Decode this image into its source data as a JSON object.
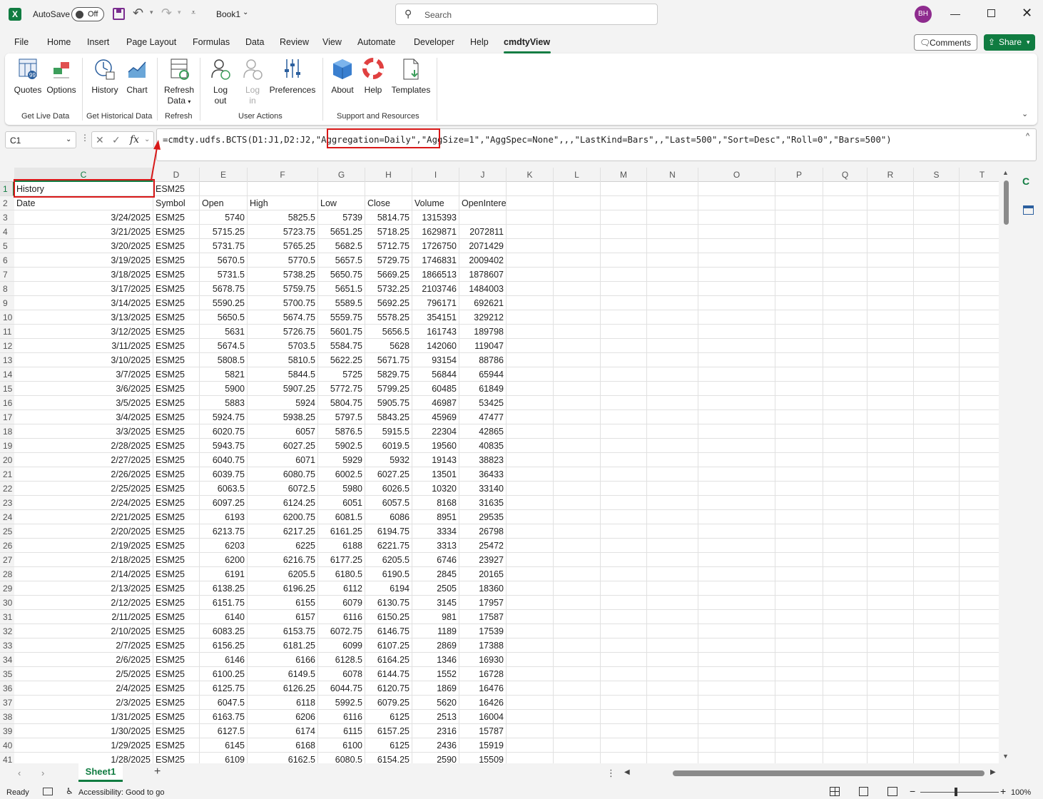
{
  "titlebar": {
    "app_logo": "X",
    "autosave_label": "AutoSave",
    "autosave_state": "Off",
    "book": "Book1",
    "search_placeholder": "Search",
    "avatar": "BH"
  },
  "menu": [
    "File",
    "Home",
    "Insert",
    "Page Layout",
    "Formulas",
    "Data",
    "Review",
    "View",
    "Automate",
    "Developer",
    "Help",
    "cmdtyView"
  ],
  "menu_active": "cmdtyView",
  "comments_label": "Comments",
  "share_label": "Share",
  "ribbon": {
    "buttons": [
      {
        "id": "quotes",
        "label": "Quotes",
        "icon": "quotes-icon"
      },
      {
        "id": "options",
        "label": "Options",
        "icon": "options-icon"
      },
      {
        "id": "history",
        "label": "History",
        "icon": "history-icon"
      },
      {
        "id": "chart",
        "label": "Chart",
        "icon": "chart-icon"
      },
      {
        "id": "refresh",
        "label": "Refresh",
        "label2": "Data",
        "icon": "refresh-data-icon"
      },
      {
        "id": "logout",
        "label": "Log",
        "label2": "out",
        "icon": "log-out-icon"
      },
      {
        "id": "login",
        "label": "Log",
        "label2": "in",
        "icon": "log-in-icon"
      },
      {
        "id": "prefs",
        "label": "Preferences",
        "icon": "preferences-icon"
      },
      {
        "id": "about",
        "label": "About",
        "icon": "about-icon"
      },
      {
        "id": "help",
        "label": "Help",
        "icon": "help-lifebuoy-icon"
      },
      {
        "id": "templates",
        "label": "Templates",
        "icon": "templates-icon"
      }
    ],
    "groups": [
      "Get Live Data",
      "Get Historical Data",
      "Refresh",
      "User Actions",
      "Support and Resources"
    ]
  },
  "namebox": "C1",
  "formula": "=cmdty.udfs.BCTS(D1:J1,D2:J2,\"Aggregation=Daily\",\"AggSize=1\",\"AggSpec=None\",,,\"LastKind=Bars\",,\"Last=500\",\"Sort=Desc\",\"Roll=0\",\"Bars=500\")",
  "columns": [
    "C",
    "D",
    "E",
    "F",
    "G",
    "H",
    "I",
    "J",
    "K",
    "L",
    "M",
    "N",
    "O",
    "P",
    "Q",
    "R",
    "S",
    "T"
  ],
  "selected_col": "C",
  "selected_row": "1",
  "row1": {
    "C": "History",
    "D": "ESM25"
  },
  "headers": [
    "Date",
    "Symbol",
    "Open",
    "High",
    "Low",
    "Close",
    "Volume",
    "OpenInterest"
  ],
  "rows": [
    [
      "3/24/2025",
      "ESM25",
      "5740",
      "5825.5",
      "5739",
      "5814.75",
      "1315393",
      ""
    ],
    [
      "3/21/2025",
      "ESM25",
      "5715.25",
      "5723.75",
      "5651.25",
      "5718.25",
      "1629871",
      "2072811"
    ],
    [
      "3/20/2025",
      "ESM25",
      "5731.75",
      "5765.25",
      "5682.5",
      "5712.75",
      "1726750",
      "2071429"
    ],
    [
      "3/19/2025",
      "ESM25",
      "5670.5",
      "5770.5",
      "5657.5",
      "5729.75",
      "1746831",
      "2009402"
    ],
    [
      "3/18/2025",
      "ESM25",
      "5731.5",
      "5738.25",
      "5650.75",
      "5669.25",
      "1866513",
      "1878607"
    ],
    [
      "3/17/2025",
      "ESM25",
      "5678.75",
      "5759.75",
      "5651.5",
      "5732.25",
      "2103746",
      "1484003"
    ],
    [
      "3/14/2025",
      "ESM25",
      "5590.25",
      "5700.75",
      "5589.5",
      "5692.25",
      "796171",
      "692621"
    ],
    [
      "3/13/2025",
      "ESM25",
      "5650.5",
      "5674.75",
      "5559.75",
      "5578.25",
      "354151",
      "329212"
    ],
    [
      "3/12/2025",
      "ESM25",
      "5631",
      "5726.75",
      "5601.75",
      "5656.5",
      "161743",
      "189798"
    ],
    [
      "3/11/2025",
      "ESM25",
      "5674.5",
      "5703.5",
      "5584.75",
      "5628",
      "142060",
      "119047"
    ],
    [
      "3/10/2025",
      "ESM25",
      "5808.5",
      "5810.5",
      "5622.25",
      "5671.75",
      "93154",
      "88786"
    ],
    [
      "3/7/2025",
      "ESM25",
      "5821",
      "5844.5",
      "5725",
      "5829.75",
      "56844",
      "65944"
    ],
    [
      "3/6/2025",
      "ESM25",
      "5900",
      "5907.25",
      "5772.75",
      "5799.25",
      "60485",
      "61849"
    ],
    [
      "3/5/2025",
      "ESM25",
      "5883",
      "5924",
      "5804.75",
      "5905.75",
      "46987",
      "53425"
    ],
    [
      "3/4/2025",
      "ESM25",
      "5924.75",
      "5938.25",
      "5797.5",
      "5843.25",
      "45969",
      "47477"
    ],
    [
      "3/3/2025",
      "ESM25",
      "6020.75",
      "6057",
      "5876.5",
      "5915.5",
      "22304",
      "42865"
    ],
    [
      "2/28/2025",
      "ESM25",
      "5943.75",
      "6027.25",
      "5902.5",
      "6019.5",
      "19560",
      "40835"
    ],
    [
      "2/27/2025",
      "ESM25",
      "6040.75",
      "6071",
      "5929",
      "5932",
      "19143",
      "38823"
    ],
    [
      "2/26/2025",
      "ESM25",
      "6039.75",
      "6080.75",
      "6002.5",
      "6027.25",
      "13501",
      "36433"
    ],
    [
      "2/25/2025",
      "ESM25",
      "6063.5",
      "6072.5",
      "5980",
      "6026.5",
      "10320",
      "33140"
    ],
    [
      "2/24/2025",
      "ESM25",
      "6097.25",
      "6124.25",
      "6051",
      "6057.5",
      "8168",
      "31635"
    ],
    [
      "2/21/2025",
      "ESM25",
      "6193",
      "6200.75",
      "6081.5",
      "6086",
      "8951",
      "29535"
    ],
    [
      "2/20/2025",
      "ESM25",
      "6213.75",
      "6217.25",
      "6161.25",
      "6194.75",
      "3334",
      "26798"
    ],
    [
      "2/19/2025",
      "ESM25",
      "6203",
      "6225",
      "6188",
      "6221.75",
      "3313",
      "25472"
    ],
    [
      "2/18/2025",
      "ESM25",
      "6200",
      "6216.75",
      "6177.25",
      "6205.5",
      "6746",
      "23927"
    ],
    [
      "2/14/2025",
      "ESM25",
      "6191",
      "6205.5",
      "6180.5",
      "6190.5",
      "2845",
      "20165"
    ],
    [
      "2/13/2025",
      "ESM25",
      "6138.25",
      "6196.25",
      "6112",
      "6194",
      "2505",
      "18360"
    ],
    [
      "2/12/2025",
      "ESM25",
      "6151.75",
      "6155",
      "6079",
      "6130.75",
      "3145",
      "17957"
    ],
    [
      "2/11/2025",
      "ESM25",
      "6140",
      "6157",
      "6116",
      "6150.25",
      "981",
      "17587"
    ],
    [
      "2/10/2025",
      "ESM25",
      "6083.25",
      "6153.75",
      "6072.75",
      "6146.75",
      "1189",
      "17539"
    ],
    [
      "2/7/2025",
      "ESM25",
      "6156.25",
      "6181.25",
      "6099",
      "6107.25",
      "2869",
      "17388"
    ],
    [
      "2/6/2025",
      "ESM25",
      "6146",
      "6166",
      "6128.5",
      "6164.25",
      "1346",
      "16930"
    ],
    [
      "2/5/2025",
      "ESM25",
      "6100.25",
      "6149.5",
      "6078",
      "6144.75",
      "1552",
      "16728"
    ],
    [
      "2/4/2025",
      "ESM25",
      "6125.75",
      "6126.25",
      "6044.75",
      "6120.75",
      "1869",
      "16476"
    ],
    [
      "2/3/2025",
      "ESM25",
      "6047.5",
      "6118",
      "5992.5",
      "6079.25",
      "5620",
      "16426"
    ],
    [
      "1/31/2025",
      "ESM25",
      "6163.75",
      "6206",
      "6116",
      "6125",
      "2513",
      "16004"
    ],
    [
      "1/30/2025",
      "ESM25",
      "6127.5",
      "6174",
      "6115",
      "6157.25",
      "2316",
      "15787"
    ],
    [
      "1/29/2025",
      "ESM25",
      "6145",
      "6168",
      "6100",
      "6125",
      "2436",
      "15919"
    ],
    [
      "1/28/2025",
      "ESM25",
      "6109",
      "6162.5",
      "6080.5",
      "6154.25",
      "2590",
      "15509"
    ]
  ],
  "sheet_tab": "Sheet1",
  "status": {
    "ready": "Ready",
    "accessibility": "Accessibility: Good to go",
    "zoom": "100%"
  }
}
